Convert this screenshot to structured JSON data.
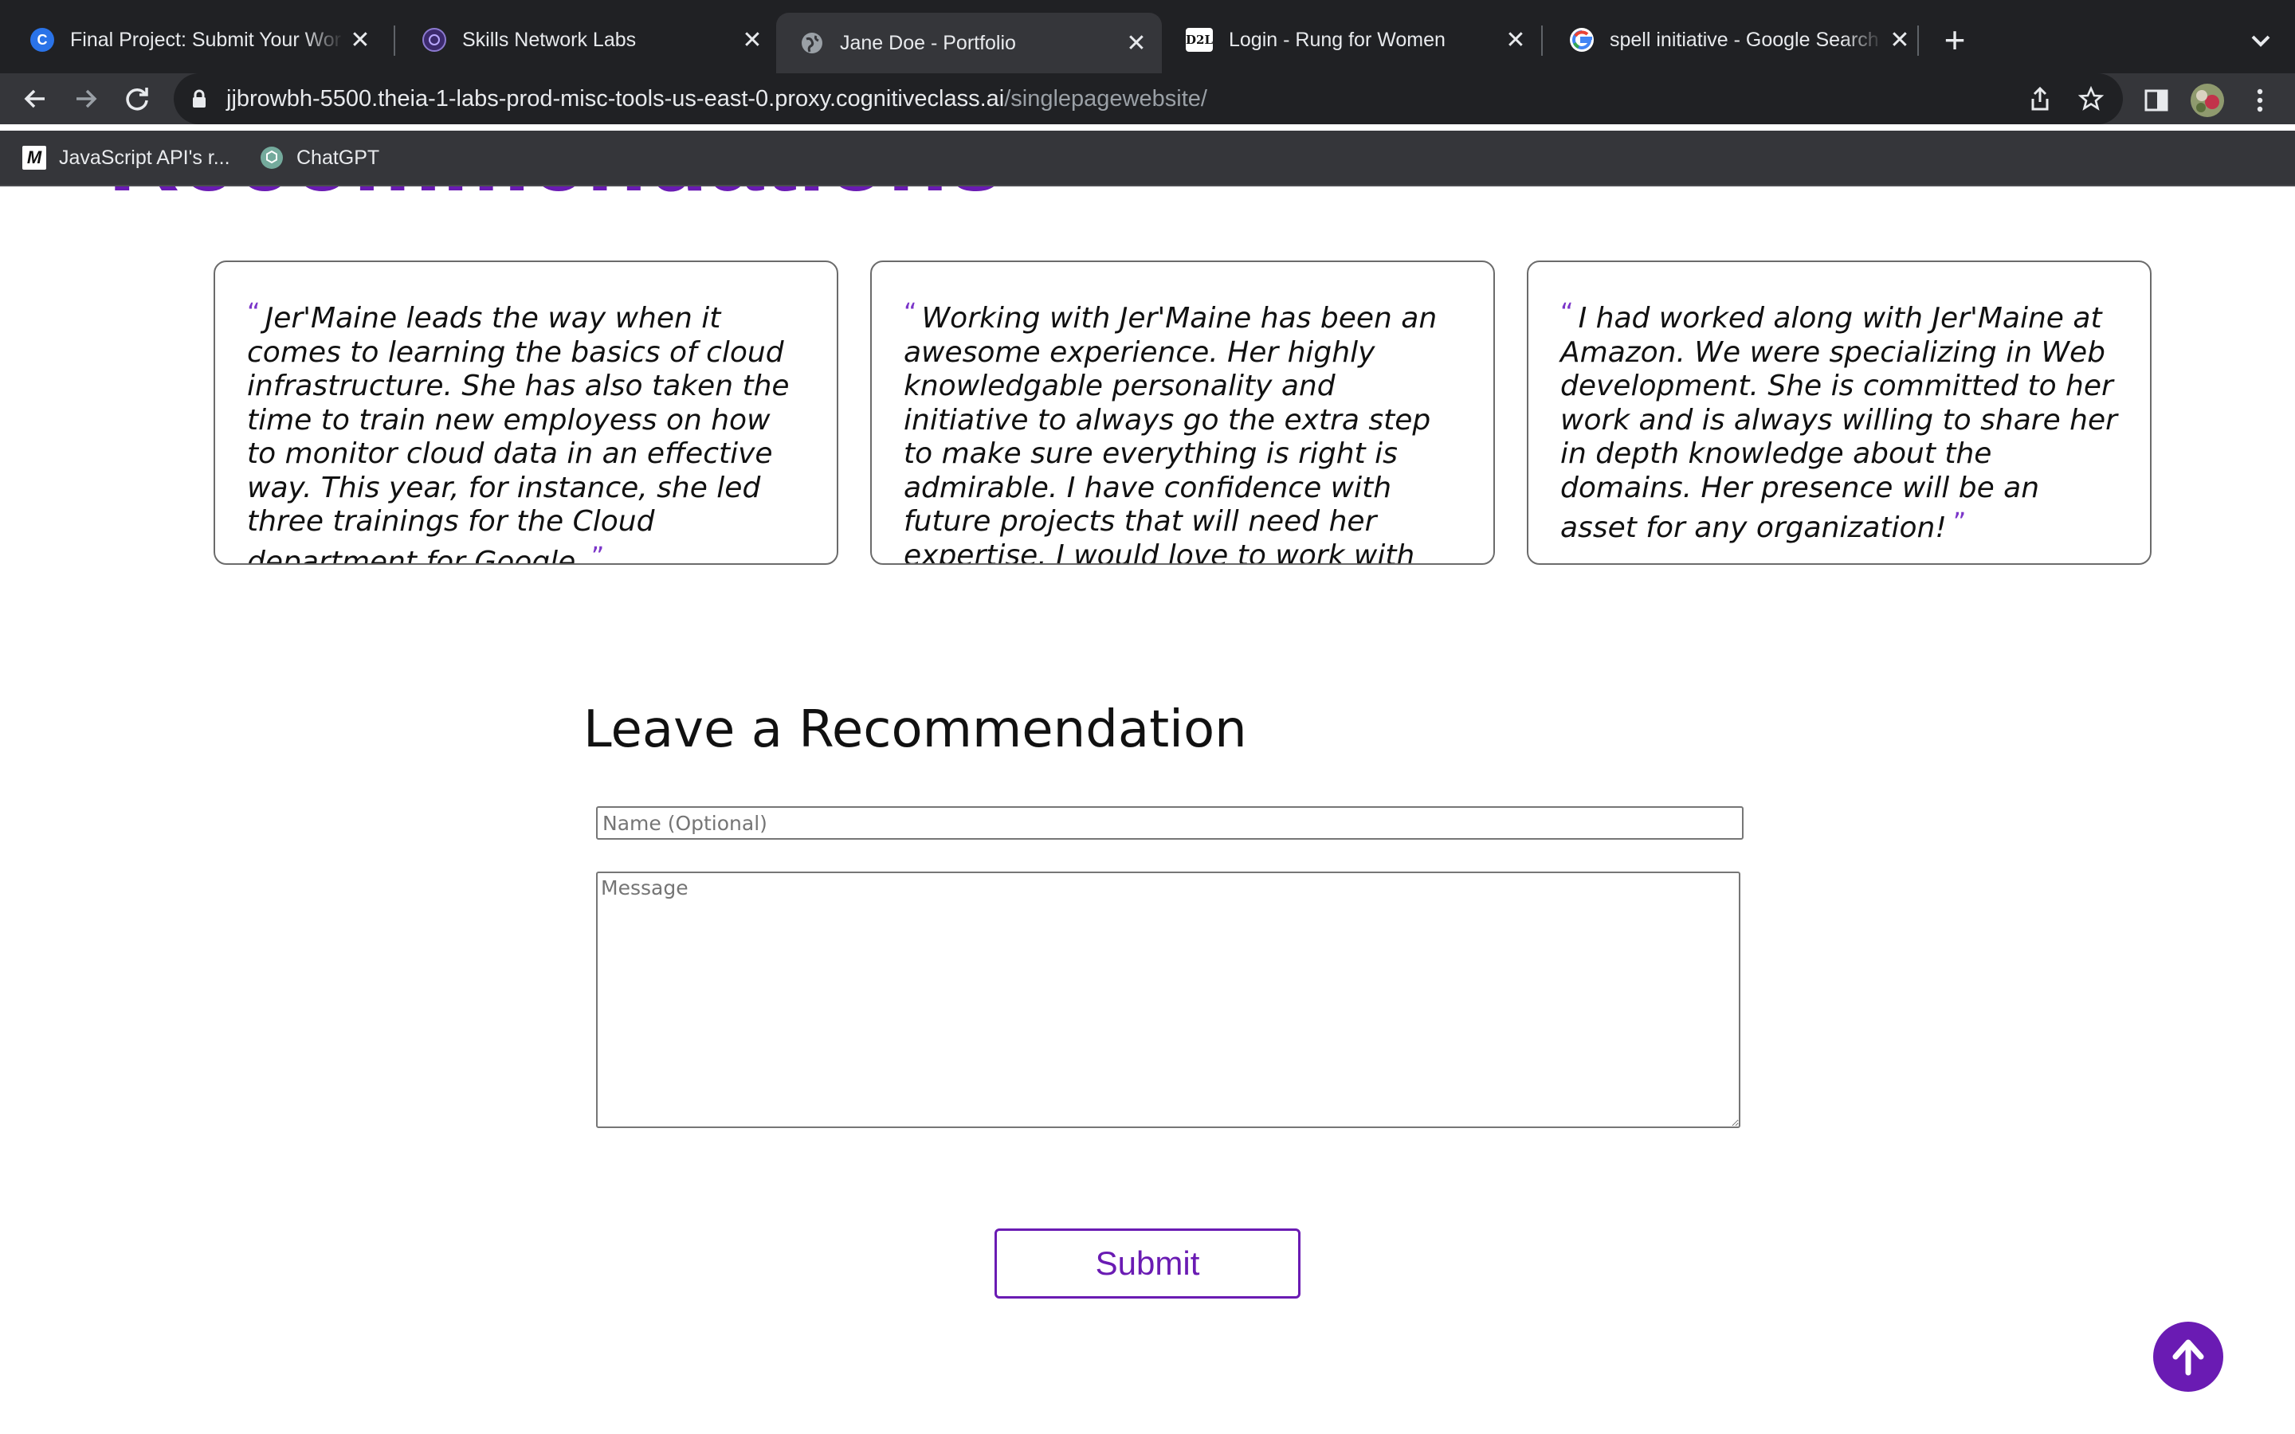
{
  "browser": {
    "tabs": [
      {
        "title": "Final Project: Submit Your Wor",
        "favicon": "coursera-icon",
        "active": false
      },
      {
        "title": "Skills Network Labs",
        "favicon": "skills-network-icon",
        "active": false
      },
      {
        "title": "Jane Doe - Portfolio",
        "favicon": "globe-icon",
        "active": true
      },
      {
        "title": "Login - Rung for Women",
        "favicon": "d2l-icon",
        "favicon_text": "D2L",
        "active": false
      },
      {
        "title": "spell initiative - Google Search",
        "favicon": "google-icon",
        "active": false
      }
    ],
    "new_tab_label": "+",
    "url_host": "jjbrowbh-5500.theia-1-labs-prod-misc-tools-us-east-0.proxy.cognitiveclass.ai",
    "url_path": "/singlepagewebsite/",
    "bookmarks": [
      {
        "label": "JavaScript API's r...",
        "icon": "mdn-icon",
        "icon_text": "M"
      },
      {
        "label": "ChatGPT",
        "icon": "chatgpt-icon"
      }
    ]
  },
  "page": {
    "section_heading": "Recommendations",
    "recommendations": [
      {
        "text": "Jer'Maine leads the way when it comes to learning the basics of cloud infrastructure. She has also taken the time to train new employess on how to monitor cloud data in an effective way. This year, for instance, she led three trainings for the Cloud department for Google."
      },
      {
        "text": "Working with Jer'Maine has been an awesome experience. Her highly knowledgable personality and initiative to always go the extra step to make sure everything is right is admirable. I have confidence with future projects that will need her expertise. I would love to work with her again one day."
      },
      {
        "text": "I had worked along with Jer'Maine at Amazon. We were specializing in Web development. She is committed to her work and is always willing to share her in depth knowledge about the domains. Her presence will be an asset for any organization!"
      }
    ],
    "quote_open": "“",
    "quote_close": "”",
    "form": {
      "title": "Leave a Recommendation",
      "name_placeholder": "Name (Optional)",
      "message_placeholder": "Message",
      "submit_label": "Submit"
    },
    "accent_color": "#6a1bb3"
  }
}
